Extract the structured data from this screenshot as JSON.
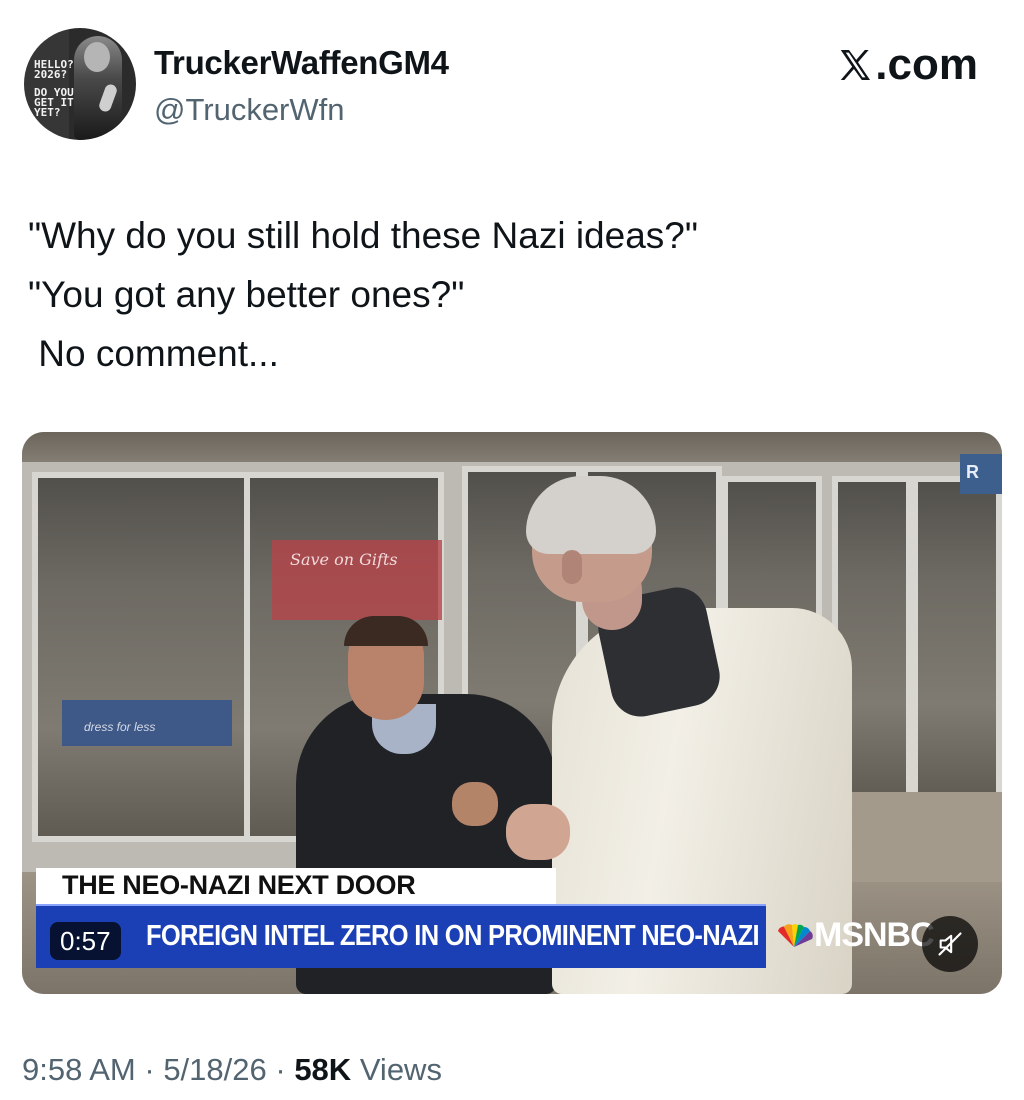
{
  "author": {
    "display_name": "TruckerWaffenGM4",
    "handle": "@TruckerWfn",
    "avatar_text": [
      "HELLO?",
      "2026?",
      "",
      "DO YOU",
      "GET IT",
      "YET?"
    ]
  },
  "site_label": ".com",
  "tweet": {
    "lines": [
      "\"Why do you still hold these Nazi ideas?\"",
      "\"You got any better ones?\"",
      " No comment..."
    ]
  },
  "video": {
    "duration": "0:57",
    "chyron_top": "THE NEO-NAZI NEXT DOOR",
    "chyron_bottom": "FOREIGN INTEL ZERO IN ON PROMINENT NEO-NAZI",
    "network": "MSNBC",
    "background_signs": {
      "store_sign": "dress for less",
      "red_sign": "Save on Gifts",
      "corner_sign": "R"
    }
  },
  "meta": {
    "time": "9:58 AM",
    "date": "5/18/26",
    "views_count": "58K",
    "views_label": "Views"
  }
}
